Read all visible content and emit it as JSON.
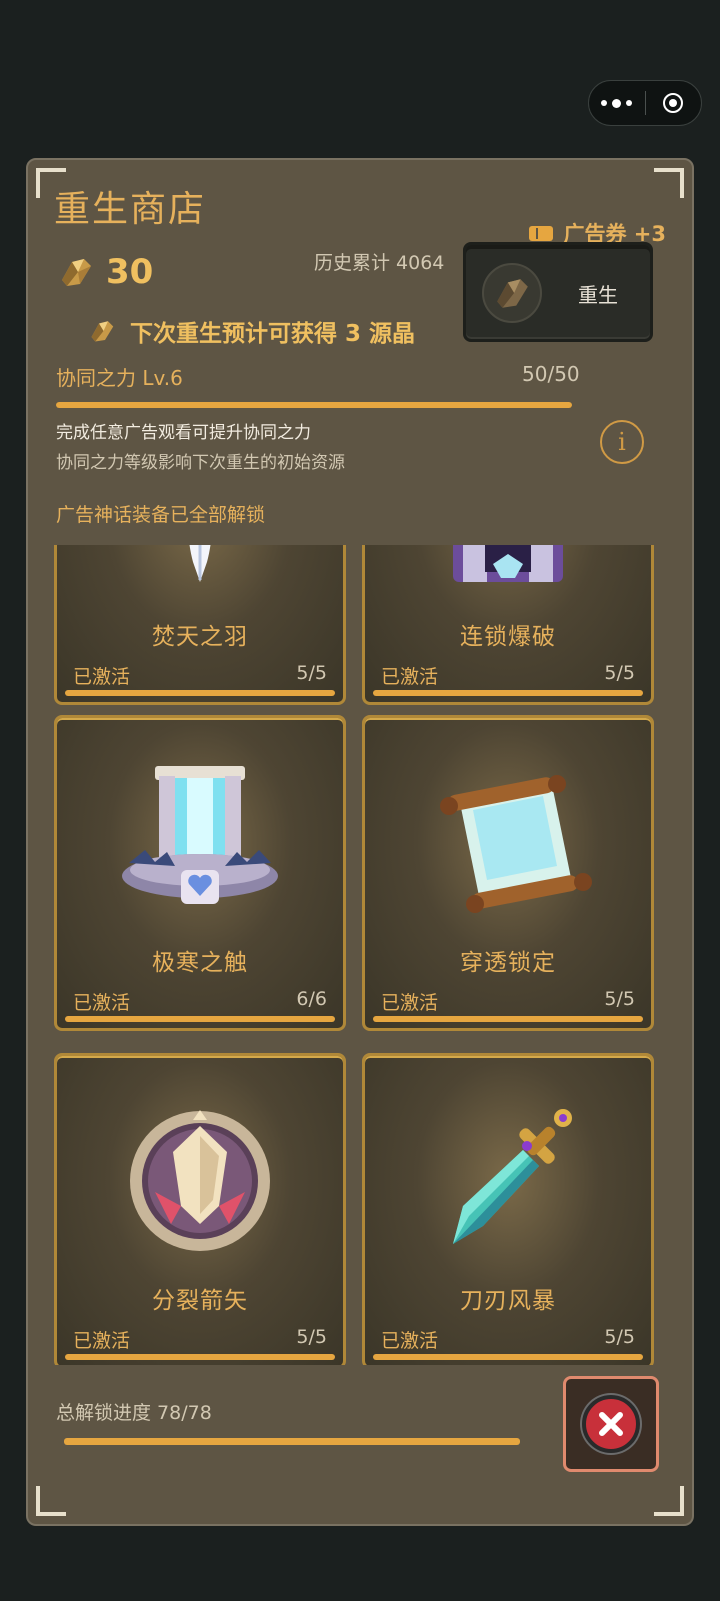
{
  "shop": {
    "title": "重生商店",
    "ad_ticket": "广告券 +3",
    "crystal_amount": "30",
    "history_total": "历史累计 4064",
    "rebirth_button": "重生",
    "next_rebirth": "下次重生预计可获得 3 源晶",
    "synergy_level": "协同之力 Lv.6",
    "synergy_progress": "50/50",
    "synergy_fraction": 1.0,
    "info_line1": "完成任意广告观看可提升协同之力",
    "info_line2": "协同之力等级影响下次重生的初始资源",
    "info_button": "i",
    "unlocked_note": "广告神话装备已全部解锁",
    "total_progress": "总解锁进度 78/78"
  },
  "cards": [
    {
      "name": "焚天之羽",
      "status": "已激活",
      "count": "5/5",
      "icon": "feather-icon"
    },
    {
      "name": "连锁爆破",
      "status": "已激活",
      "count": "5/5",
      "icon": "chain-blast-icon"
    },
    {
      "name": "极寒之触",
      "status": "已激活",
      "count": "6/6",
      "icon": "frost-fountain-icon"
    },
    {
      "name": "穿透锁定",
      "status": "已激活",
      "count": "5/5",
      "icon": "scroll-icon"
    },
    {
      "name": "分裂箭矢",
      "status": "已激活",
      "count": "5/5",
      "icon": "crest-shield-icon"
    },
    {
      "name": "刀刃风暴",
      "status": "已激活",
      "count": "5/5",
      "icon": "crystal-sword-icon"
    }
  ],
  "colors": {
    "panel_bg": "#5e5544",
    "gold_text": "#e6b15c",
    "bar_fill": "#e6a640",
    "card_border": "#b08838",
    "close_red": "#c8303a"
  }
}
